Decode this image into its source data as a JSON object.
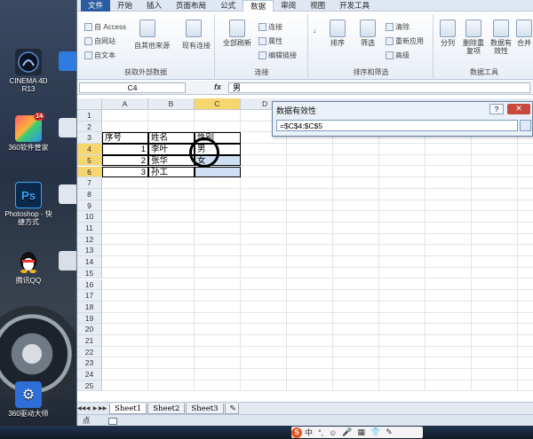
{
  "desktop": {
    "icons": [
      {
        "label": "CINEMA 4D R13",
        "glyph": "C4"
      },
      {
        "label": "360软件管家",
        "glyph": "14"
      },
      {
        "label": "Photoshop - 快捷方式",
        "glyph": "Ps"
      },
      {
        "label": "腾讯QQ",
        "glyph": "QQ"
      },
      {
        "label": "360驱动大师",
        "glyph": "⚙"
      }
    ]
  },
  "ribbon": {
    "tabs": [
      "文件",
      "开始",
      "插入",
      "页面布局",
      "公式",
      "数据",
      "审阅",
      "视图",
      "开发工具"
    ],
    "active_tab": "数据",
    "groups": {
      "external": {
        "label": "获取外部数据",
        "items": [
          "自 Access",
          "自网站",
          "自文本",
          "自其他来源",
          "现有连接"
        ]
      },
      "connections": {
        "label": "连接",
        "refresh": "全部刷新",
        "items": [
          "连接",
          "属性",
          "编辑链接"
        ]
      },
      "sort_filter": {
        "label": "排序和筛选",
        "sort": "排序",
        "filter": "筛选",
        "items": [
          "清除",
          "重新应用",
          "高级"
        ]
      },
      "data_tools": {
        "label": "数据工具",
        "items": [
          "分列",
          "删除重复项",
          "数据有效性",
          "合并"
        ]
      }
    }
  },
  "formula_bar": {
    "name_box": "C4",
    "fx": "fx",
    "value": "男"
  },
  "grid": {
    "columns": [
      "A",
      "B",
      "C",
      "D"
    ],
    "selected_column": "C",
    "rows": [
      "1",
      "2",
      "3",
      "4",
      "5",
      "6",
      "7",
      "8",
      "9",
      "10",
      "11",
      "12",
      "13",
      "14",
      "15",
      "16",
      "17",
      "18",
      "19",
      "20",
      "21",
      "22",
      "23",
      "24",
      "25"
    ],
    "cells": {
      "A3": "序号",
      "B3": "姓名",
      "C3": "性别",
      "A4": "1",
      "B4": "李叶",
      "C4": "男",
      "A5": "2",
      "B5": "张华",
      "C5": "女",
      "A6": "3",
      "B6": "孙工",
      "C6": ""
    }
  },
  "sheet_tabs": [
    "Sheet1",
    "Sheet2",
    "Sheet3"
  ],
  "active_sheet": "Sheet1",
  "status": "点",
  "dialog": {
    "title": "数据有效性",
    "help": "?",
    "close": "✕",
    "input_value": "=$C$4:$C$5"
  },
  "ime": {
    "logo": "S",
    "mode": "中",
    "items": [
      "°,",
      "☺",
      "🎤",
      "▦",
      "👕",
      "✎"
    ]
  }
}
